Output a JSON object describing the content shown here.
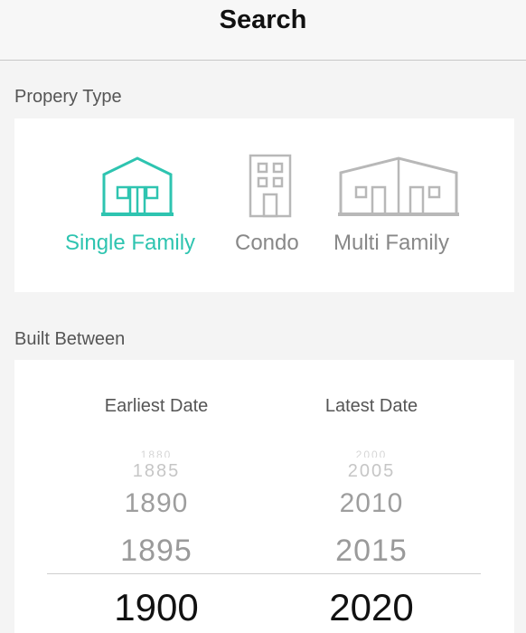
{
  "nav": {
    "title": "Search"
  },
  "property_type": {
    "label": "Propery Type",
    "options": [
      {
        "label": "Single Family",
        "icon": "single-family-house-icon",
        "selected": true
      },
      {
        "label": "Condo",
        "icon": "condo-building-icon",
        "selected": false
      },
      {
        "label": "Multi Family",
        "icon": "multi-family-house-icon",
        "selected": false
      }
    ]
  },
  "built_between": {
    "label": "Built Between",
    "earliest": {
      "header": "Earliest Date",
      "far": "1880",
      "m3": "1885",
      "m2": "1890",
      "m1": "1895",
      "selected": "1900"
    },
    "latest": {
      "header": "Latest Date",
      "far": "2000",
      "m3": "2005",
      "m2": "2010",
      "m1": "2015",
      "selected": "2020"
    }
  },
  "colors": {
    "accent": "#2ec4b0",
    "inactive": "#b8b8b8",
    "background": "#f4f4f4"
  }
}
